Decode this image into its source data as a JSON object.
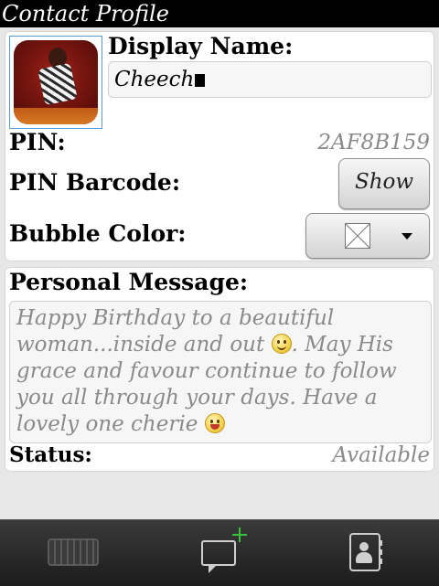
{
  "title_bar": {
    "title": "Contact Profile"
  },
  "profile": {
    "display_name_label": "Display Name:",
    "display_name_value": "Cheech",
    "pin_label": "PIN:",
    "pin_value": "2AF8B159",
    "pin_barcode_label": "PIN Barcode:",
    "show_button_label": "Show",
    "bubble_color_label": "Bubble Color:"
  },
  "message": {
    "personal_message_label": "Personal Message:",
    "text_part1": "Happy Birthday to a beautiful woman...inside and out ",
    "text_part2": ". May His grace and favour continue to follow you all through your days. Have a lovely one cherie ",
    "status_label": "Status:",
    "status_value": "Available"
  },
  "icons": {
    "keyboard": "keyboard-icon",
    "new_chat": "chat-bubble-icon",
    "add": "plus-icon",
    "contacts": "contacts-icon",
    "emoji_smile": "smile-emoji-icon",
    "emoji_grin": "grin-emoji-icon"
  },
  "colors": {
    "accent_green": "#39c139",
    "title_bg": "#000000"
  }
}
